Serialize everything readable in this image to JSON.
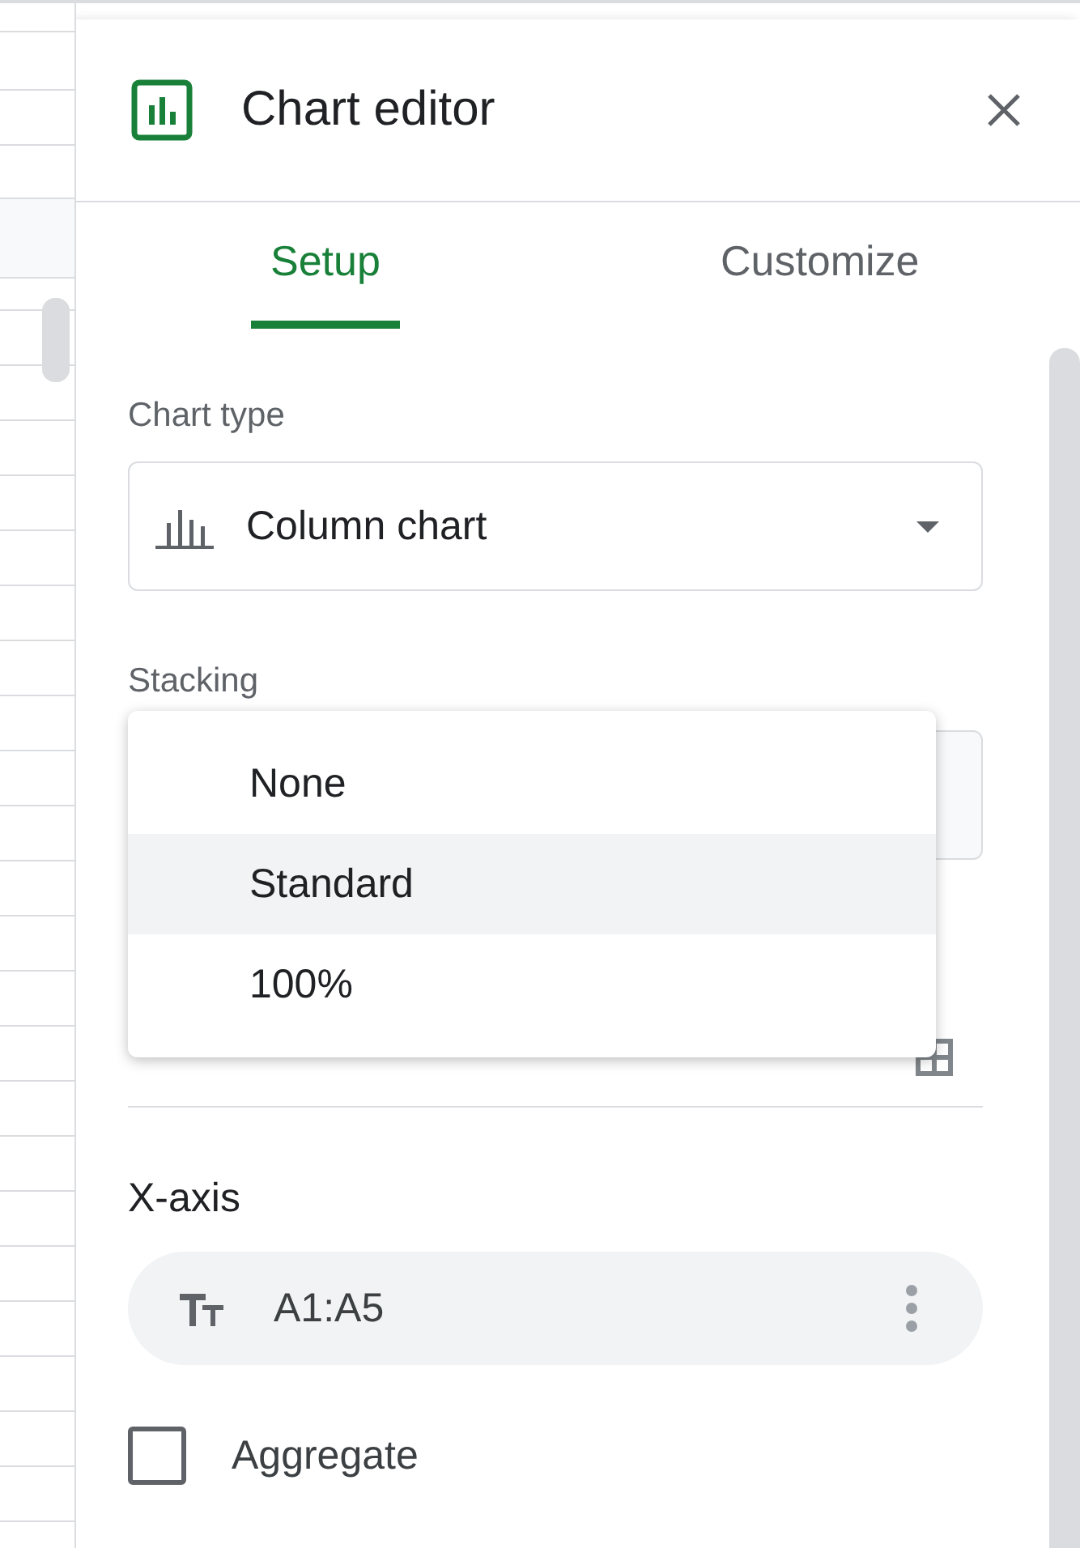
{
  "panel": {
    "title": "Chart editor"
  },
  "tabs": [
    {
      "label": "Setup",
      "selected": true
    },
    {
      "label": "Customize",
      "selected": false
    }
  ],
  "chart_type": {
    "label": "Chart type",
    "value": "Column chart"
  },
  "stacking": {
    "label": "Stacking",
    "menu": [
      {
        "label": "None",
        "selected": false
      },
      {
        "label": "Standard",
        "selected": true
      },
      {
        "label": "100%",
        "selected": false
      }
    ]
  },
  "x_axis": {
    "label": "X-axis",
    "range": "A1:A5"
  },
  "options": [
    {
      "label": "Aggregate",
      "checked": false
    }
  ]
}
